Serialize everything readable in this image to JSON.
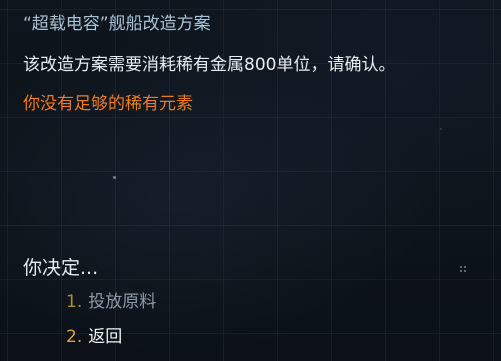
{
  "dialog": {
    "title": "“超载电容”舰船改造方案",
    "description": "该改造方案需要消耗稀有金属800单位，请确认。",
    "warning": "你没有足够的稀有元素",
    "prompt": "你决定...",
    "options": [
      {
        "number": "1.",
        "label": "投放原料"
      },
      {
        "number": "2.",
        "label": "返回"
      }
    ]
  },
  "colors": {
    "title": "#a9c2d6",
    "text": "#e7ecef",
    "warning": "#f07a1e",
    "option_number": "#e0a23c",
    "option_dim": "#8b9aa6",
    "background": "#0c1218"
  },
  "icons": [
    "drag-handle-icon"
  ]
}
